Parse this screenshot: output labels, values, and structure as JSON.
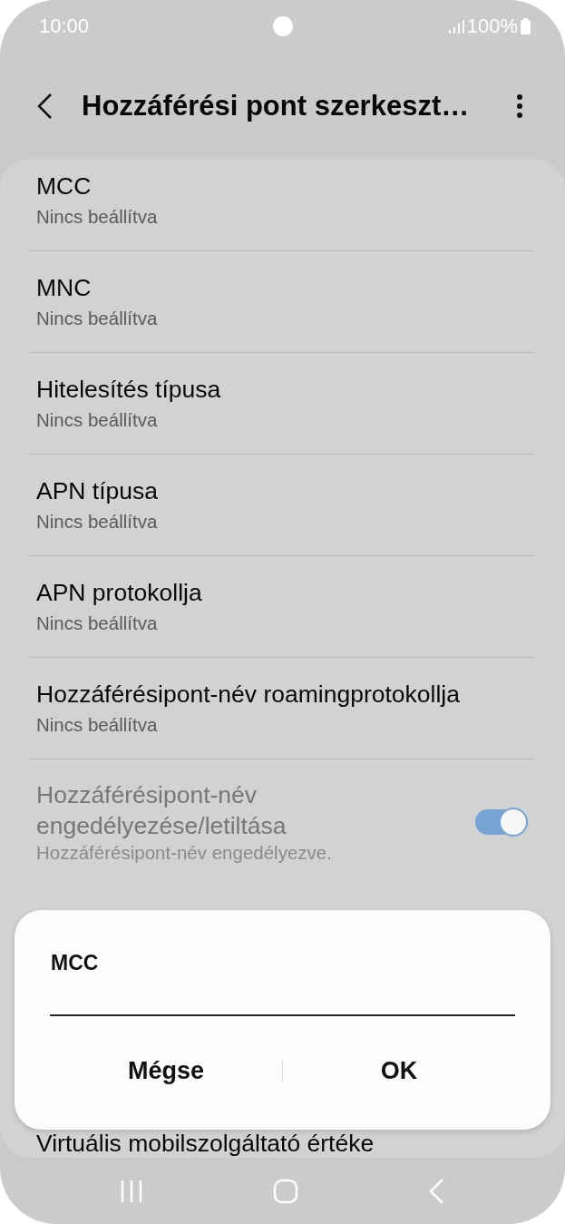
{
  "status_bar": {
    "time": "10:00",
    "battery": "100%"
  },
  "header": {
    "title": "Hozzáférési pont szerkeszt…"
  },
  "settings": [
    {
      "kind": "text",
      "title": "MCC",
      "value": "Nincs beállítva",
      "disabled": false
    },
    {
      "kind": "text",
      "title": "MNC",
      "value": "Nincs beállítva",
      "disabled": false
    },
    {
      "kind": "text",
      "title": "Hitelesítés típusa",
      "value": "Nincs beállítva",
      "disabled": false
    },
    {
      "kind": "text",
      "title": "APN típusa",
      "value": "Nincs beállítva",
      "disabled": false
    },
    {
      "kind": "text",
      "title": "APN protokollja",
      "value": "Nincs beállítva",
      "disabled": false
    },
    {
      "kind": "text",
      "title": "Hozzáférésipont-név roamingprotokollja",
      "value": "Nincs beállítva",
      "disabled": false
    },
    {
      "kind": "toggle",
      "title": "Hozzáférésipont-név engedélyezése/letiltása",
      "value": "Hozzáférésipont-név engedélyezve.",
      "disabled": true,
      "on": true
    },
    {
      "kind": "text",
      "title": "Virtuális mobilszolgáltató értéke",
      "disabled": false
    }
  ],
  "dialog": {
    "title": "MCC",
    "buttons": [
      "Mégse",
      "OK"
    ]
  }
}
